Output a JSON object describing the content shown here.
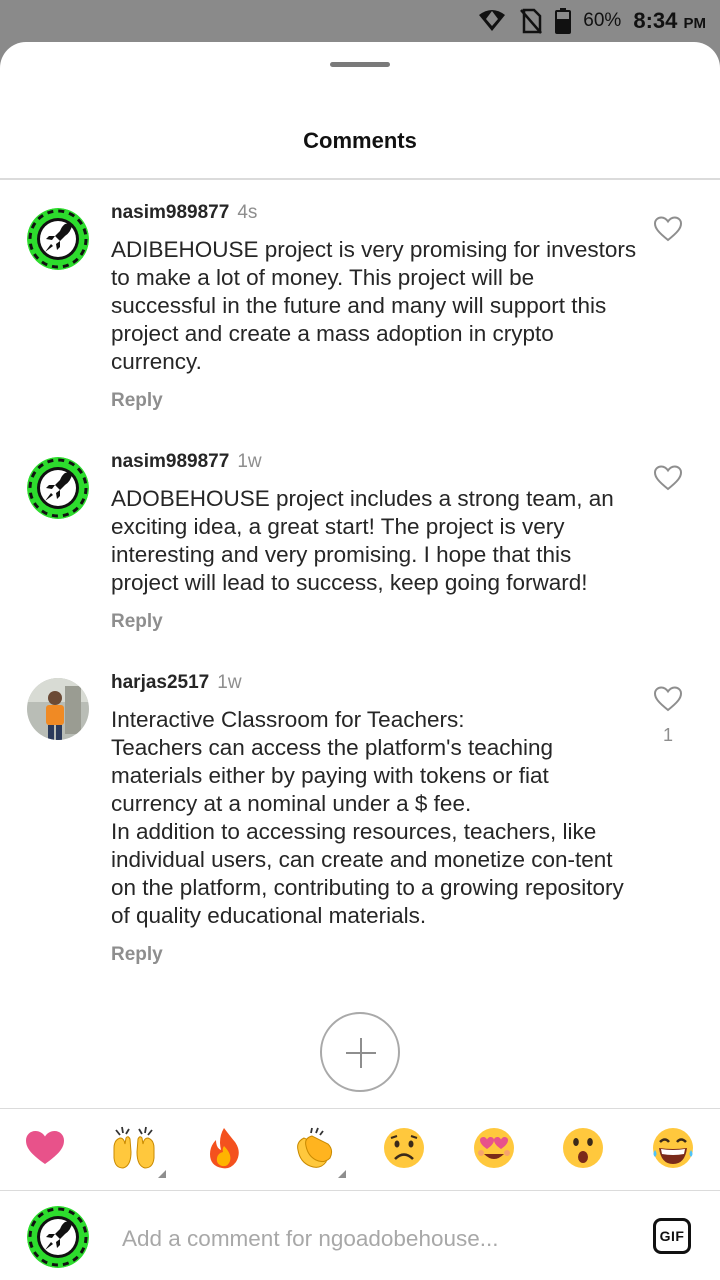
{
  "status_bar": {
    "battery": "60%",
    "time": "8:34",
    "time_suffix": "PM",
    "icons": [
      "wifi-icon",
      "no-sim-icon",
      "battery-icon"
    ]
  },
  "sheet": {
    "title": "Comments"
  },
  "comments": [
    {
      "username": "nasim989877",
      "time": "4s",
      "text": "ADIBEHOUSE project is very promising for investors to make a lot of money. This project will be successful in the future and many will support this project and create a mass adoption in crypto currency.",
      "reply_label": "Reply",
      "avatar": "rocket-logo-avatar"
    },
    {
      "username": "nasim989877",
      "time": "1w",
      "text": "ADOBEHOUSE project includes a strong team, an exciting idea, a great start! The project is very interesting and very promising. I hope that this project will lead to success, keep going forward!",
      "reply_label": "Reply",
      "avatar": "rocket-logo-avatar"
    },
    {
      "username": "harjas2517",
      "time": "1w",
      "text": "Interactive Classroom for Teachers:\nTeachers can access the platform's teaching materials either by paying with tokens or fiat currency at a nominal under a $ fee.\nIn addition to accessing resources, teachers, like individual users, can create and monetize con-tent on the platform, contributing to a growing repository of quality educational materials.",
      "reply_label": "Reply",
      "like_count": "1",
      "avatar": "person-photo-avatar"
    }
  ],
  "emoji_bar": [
    "heart",
    "raised-hands",
    "fire",
    "clapping-hands",
    "frowning-face",
    "heart-eyes-face",
    "surprised-face",
    "laughing-face"
  ],
  "composer": {
    "placeholder": "Add a comment for ngoadobehouse...",
    "gif_label": "GIF"
  },
  "colors": {
    "accent_green": "#2ddc2d",
    "heart_pink": "#e8528a",
    "emoji_yellow": "#ffc83d",
    "muted_text": "#8e8e8e"
  }
}
